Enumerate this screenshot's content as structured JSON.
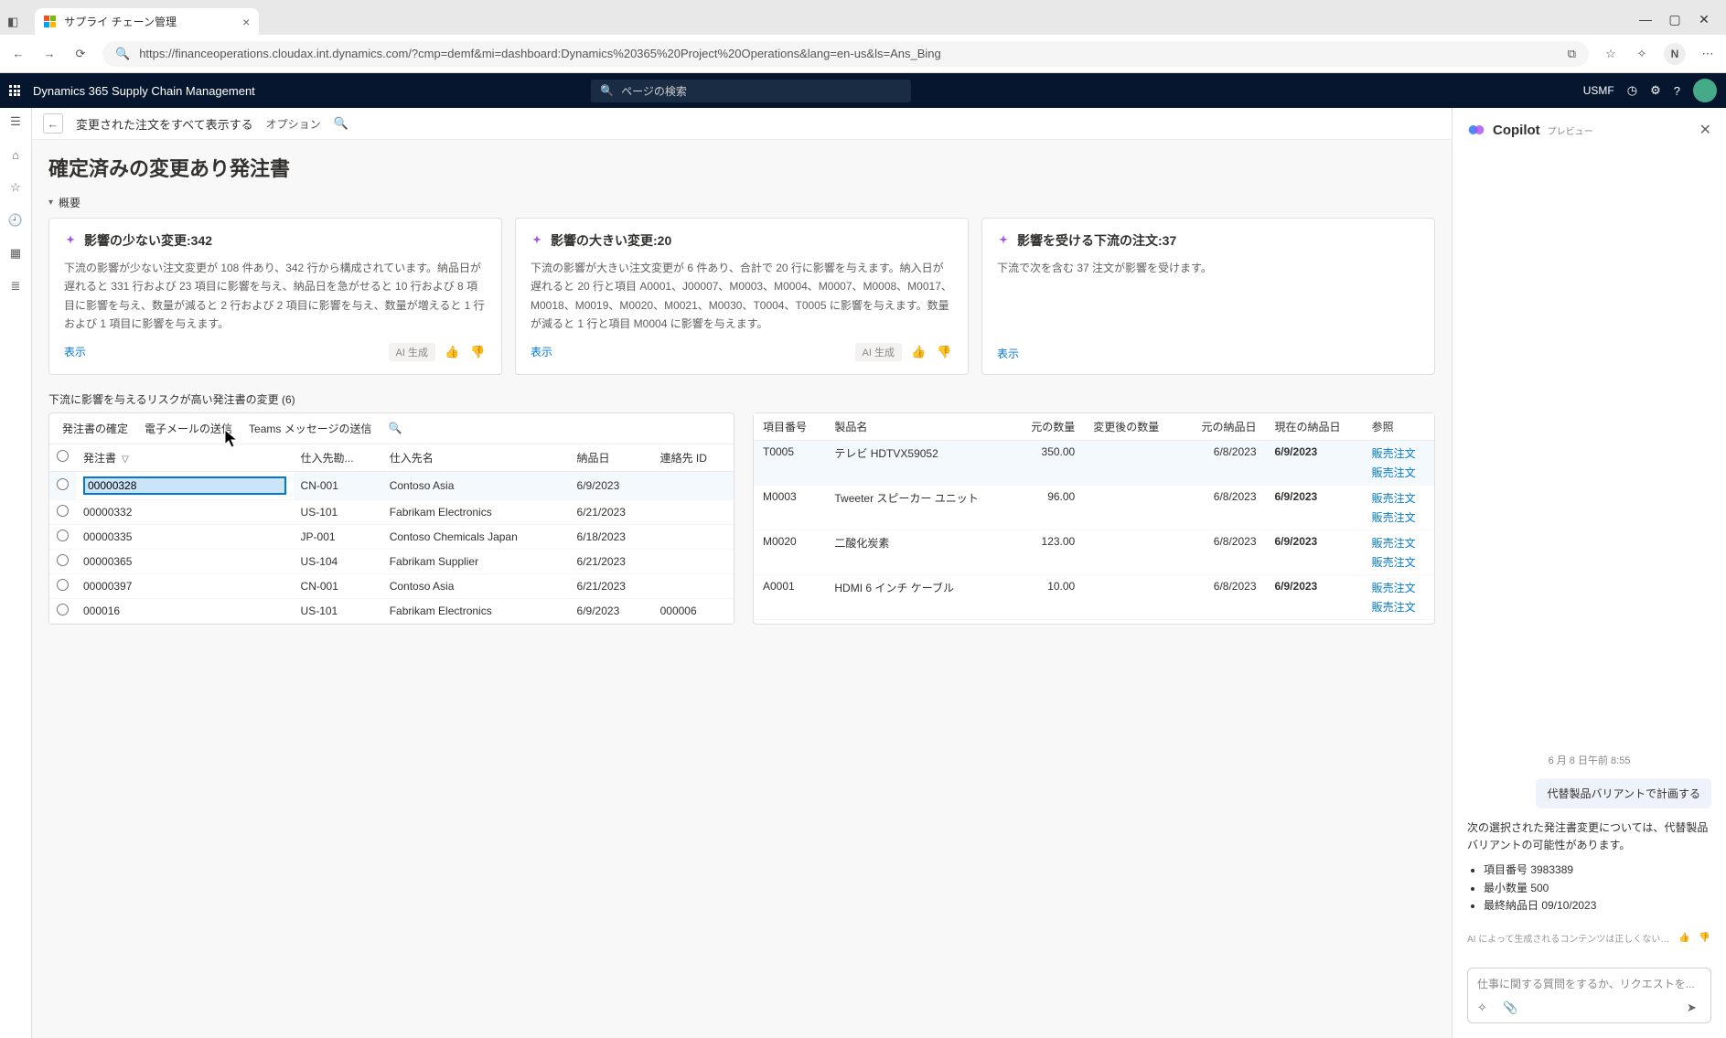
{
  "browser": {
    "tab_title": "サプライ チェーン管理",
    "url": "https://financeoperations.cloudax.int.dynamics.com/?cmp=demf&mi=dashboard:Dynamics%20365%20Project%20Operations&lang=en-us&ls=Ans_Bing",
    "avatar_letter": "N"
  },
  "d365": {
    "product": "Dynamics 365 Supply Chain Management",
    "search_placeholder": "ページの検索",
    "company": "USMF"
  },
  "cmdbar": {
    "back_tip": "←",
    "title": "変更された注文をすべて表示する",
    "options": "オプション"
  },
  "page": {
    "title": "確定済みの変更あり発注書",
    "overview": "概要"
  },
  "cards": [
    {
      "title": "影響の少ない変更:342",
      "desc": "下流の影響が少ない注文変更が 108 件あり、342 行から構成されています。納品日が遅れると 331 行および 23 項目に影響を与え、納品日を急がせると 10 行および 8 項目に影響を与え、数量が減ると 2 行および 2 項目に影響を与え、数量が増えると 1 行および 1 項目に影響を与えます。",
      "show": "表示",
      "ai": "AI 生成"
    },
    {
      "title": "影響の大きい変更:20",
      "desc": "下流の影響が大きい注文変更が 6 件あり、合計で 20 行に影響を与えます。納入日が遅れると 20 行と項目 A0001、J00007、M0003、M0004、M0007、M0008、M0017、M0018、M0019、M0020、M0021、M0030、T0004、T0005 に影響を与えます。数量が減ると 1 行と項目 M0004 に影響を与えます。",
      "show": "表示",
      "ai": "AI 生成"
    },
    {
      "title": "影響を受ける下流の注文:37",
      "desc": "下流で次を含む 37 注文が影響を受けます。",
      "show": "表示",
      "ai": ""
    }
  ],
  "section_title": "下流に影響を与えるリスクが高い発注書の変更 (6)",
  "toolbar": {
    "confirm": "発注書の確定",
    "email": "電子メールの送信",
    "teams": "Teams メッセージの送信"
  },
  "left_table": {
    "cols": {
      "po": "発注書",
      "vendAcct": "仕入先勘...",
      "vendName": "仕入先名",
      "delivery": "納品日",
      "contact": "連絡先 ID"
    },
    "rows": [
      {
        "po": "00000328",
        "vendAcct": "CN-001",
        "vendName": "Contoso Asia",
        "delivery": "6/9/2023",
        "contact": ""
      },
      {
        "po": "00000332",
        "vendAcct": "US-101",
        "vendName": "Fabrikam Electronics",
        "delivery": "6/21/2023",
        "contact": ""
      },
      {
        "po": "00000335",
        "vendAcct": "JP-001",
        "vendName": "Contoso Chemicals Japan",
        "delivery": "6/18/2023",
        "contact": ""
      },
      {
        "po": "00000365",
        "vendAcct": "US-104",
        "vendName": "Fabrikam Supplier",
        "delivery": "6/21/2023",
        "contact": ""
      },
      {
        "po": "00000397",
        "vendAcct": "CN-001",
        "vendName": "Contoso Asia",
        "delivery": "6/21/2023",
        "contact": ""
      },
      {
        "po": "000016",
        "vendAcct": "US-101",
        "vendName": "Fabrikam Electronics",
        "delivery": "6/9/2023",
        "contact": "000006"
      }
    ]
  },
  "right_table": {
    "cols": {
      "item": "項目番号",
      "prod": "製品名",
      "origQty": "元の数量",
      "newQty": "変更後の数量",
      "origDate": "元の納品日",
      "curDate": "現在の納品日",
      "ref": "参照"
    },
    "rows": [
      {
        "item": "T0005",
        "prod": "テレビ HDTVX59052",
        "origQty": "350.00",
        "newQty": "",
        "origDate": "6/8/2023",
        "curDate": "6/9/2023",
        "refs": [
          "販売注文",
          "販売注文"
        ]
      },
      {
        "item": "M0003",
        "prod": "Tweeter スピーカー ユニット",
        "origQty": "96.00",
        "newQty": "",
        "origDate": "6/8/2023",
        "curDate": "6/9/2023",
        "refs": [
          "販売注文",
          "販売注文"
        ]
      },
      {
        "item": "M0020",
        "prod": "二酸化炭素",
        "origQty": "123.00",
        "newQty": "",
        "origDate": "6/8/2023",
        "curDate": "6/9/2023",
        "refs": [
          "販売注文",
          "販売注文"
        ]
      },
      {
        "item": "A0001",
        "prod": "HDMI 6 インチ ケーブル",
        "origQty": "10.00",
        "newQty": "",
        "origDate": "6/8/2023",
        "curDate": "6/9/2023",
        "refs": [
          "販売注文",
          "販売注文"
        ]
      }
    ]
  },
  "copilot": {
    "title": "Copilot",
    "preview": "プレビュー",
    "timestamp": "6 月 8 日午前 8:55",
    "user_msg": "代替製品バリアントで計画する",
    "bot_msg": "次の選択された発注書変更については、代替製品バリアントの可能性があります。",
    "bullets": [
      "項目番号 3983389",
      "最小数量 500",
      "最終納品日 09/10/2023"
    ],
    "disclaimer": "AI によって生成されるコンテンツは正しくない…",
    "placeholder": "仕事に関する質問をするか、リクエストを..."
  }
}
